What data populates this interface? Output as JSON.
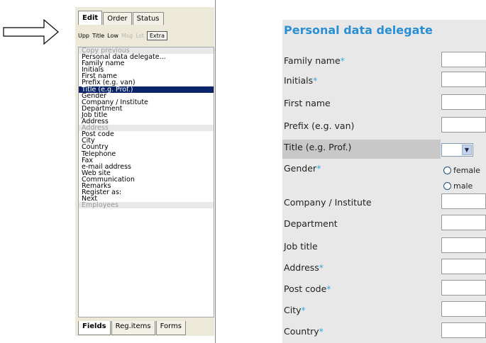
{
  "editor": {
    "top_tabs": [
      {
        "label": "Edit",
        "active": true
      },
      {
        "label": "Order",
        "active": false
      },
      {
        "label": "Status",
        "active": false
      }
    ],
    "toolbar": [
      {
        "label": "Upp",
        "state": "normal"
      },
      {
        "label": "Title",
        "state": "normal"
      },
      {
        "label": "Low",
        "state": "normal"
      },
      {
        "label": "Msg",
        "state": "disabled"
      },
      {
        "label": "Lst",
        "state": "disabled"
      },
      {
        "label": "Extra",
        "state": "boxed"
      }
    ],
    "fields": [
      {
        "label": "Copy previous",
        "kind": "header"
      },
      {
        "label": "Personal data delegate...",
        "kind": "item"
      },
      {
        "label": "Family name",
        "kind": "item"
      },
      {
        "label": "Initials",
        "kind": "item"
      },
      {
        "label": "First name",
        "kind": "item"
      },
      {
        "label": "Prefix (e.g. van)",
        "kind": "item"
      },
      {
        "label": "Title (e.g. Prof.)",
        "kind": "selected"
      },
      {
        "label": "Gender",
        "kind": "item"
      },
      {
        "label": "Company / Institute",
        "kind": "item"
      },
      {
        "label": "Department",
        "kind": "item"
      },
      {
        "label": "Job title",
        "kind": "item"
      },
      {
        "label": "Address",
        "kind": "item"
      },
      {
        "label": "Address",
        "kind": "header"
      },
      {
        "label": "Post code",
        "kind": "item"
      },
      {
        "label": "City",
        "kind": "item"
      },
      {
        "label": "Country",
        "kind": "item"
      },
      {
        "label": "Telephone",
        "kind": "item"
      },
      {
        "label": "Fax",
        "kind": "item"
      },
      {
        "label": "e-mail address",
        "kind": "item"
      },
      {
        "label": "Web site",
        "kind": "item"
      },
      {
        "label": "Communication",
        "kind": "item"
      },
      {
        "label": "Remarks",
        "kind": "item"
      },
      {
        "label": "Register as:",
        "kind": "item"
      },
      {
        "label": "Next",
        "kind": "item"
      },
      {
        "label": "Employees",
        "kind": "header"
      }
    ],
    "bottom_tabs": [
      {
        "label": "Fields",
        "active": true
      },
      {
        "label": "Reg.items",
        "active": false
      },
      {
        "label": "Forms",
        "active": false
      }
    ]
  },
  "form": {
    "title": "Personal data delegate",
    "required_marker": "*",
    "rows": [
      {
        "label": "Family name",
        "required": true,
        "control": "input"
      },
      {
        "label": "Initials",
        "required": true,
        "control": "input"
      },
      {
        "label": "First name",
        "required": false,
        "control": "input"
      },
      {
        "label": "Prefix (e.g. van)",
        "required": false,
        "control": "input"
      },
      {
        "label": "Title (e.g. Prof.)",
        "required": false,
        "control": "select",
        "highlighted": true
      },
      {
        "label": "Gender",
        "required": true,
        "control": "radio"
      },
      {
        "label": "Company / Institute",
        "required": false,
        "control": "input"
      },
      {
        "label": "Department",
        "required": false,
        "control": "input"
      },
      {
        "label": "Job title",
        "required": false,
        "control": "input"
      },
      {
        "label": "Address",
        "required": true,
        "control": "input"
      },
      {
        "label": "Post code",
        "required": true,
        "control": "input"
      },
      {
        "label": "City",
        "required": true,
        "control": "input"
      },
      {
        "label": "Country",
        "required": true,
        "control": "input"
      }
    ],
    "gender_options": [
      "female",
      "male"
    ],
    "select_arrow": "chevron-down-icon"
  },
  "colors": {
    "title": "#2a8fd4",
    "required": "#33a6e0",
    "selection": "#0a246a",
    "form_bg": "#e8e8e8"
  }
}
